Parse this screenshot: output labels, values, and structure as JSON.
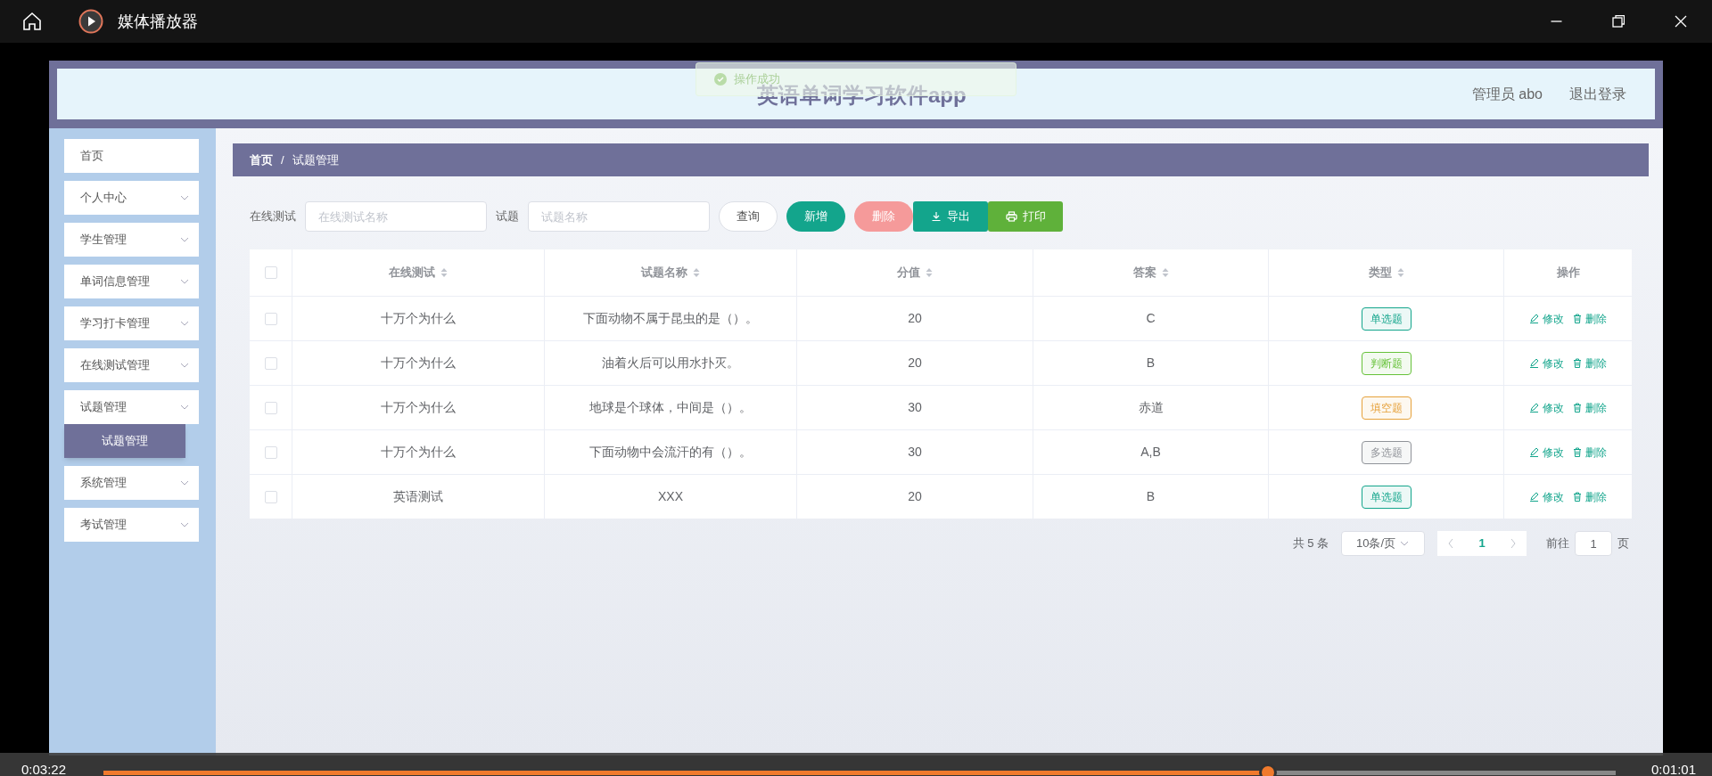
{
  "window": {
    "title": "媒体播放器"
  },
  "toast": {
    "text": "操作成功"
  },
  "header": {
    "title": "英语单词学习软件app",
    "user": "管理员 abo",
    "logout": "退出登录"
  },
  "sidebar": {
    "items": [
      {
        "label": "首页",
        "kind": "link"
      },
      {
        "label": "个人中心",
        "kind": "submenu"
      },
      {
        "label": "学生管理",
        "kind": "submenu"
      },
      {
        "label": "单词信息管理",
        "kind": "submenu"
      },
      {
        "label": "学习打卡管理",
        "kind": "submenu"
      },
      {
        "label": "在线测试管理",
        "kind": "submenu"
      },
      {
        "label": "试题管理",
        "kind": "submenu",
        "children": [
          {
            "label": "试题管理",
            "selected": true
          }
        ]
      },
      {
        "label": "系统管理",
        "kind": "submenu"
      },
      {
        "label": "考试管理",
        "kind": "submenu"
      }
    ]
  },
  "breadcrumb": [
    "首页",
    "/",
    "试题管理"
  ],
  "search": [
    {
      "label": "在线测试",
      "placeholder": "在线测试名称"
    },
    {
      "label": "试题",
      "placeholder": "试题名称"
    }
  ],
  "buttons": [
    {
      "label": "查询",
      "kind": "query"
    },
    {
      "label": "新增",
      "kind": "add"
    },
    {
      "label": "删除",
      "kind": "delete",
      "disabled": true
    },
    {
      "label": "导出",
      "kind": "export"
    },
    {
      "label": "打印",
      "kind": "print"
    }
  ],
  "table": {
    "select_all": {
      "checked": false
    },
    "columns": [
      {
        "label": "在线测试",
        "sortable": true
      },
      {
        "label": "试题名称",
        "sortable": true
      },
      {
        "label": "分值",
        "sortable": true
      },
      {
        "label": "答案",
        "sortable": true
      },
      {
        "label": "类型",
        "sortable": true
      },
      {
        "label": "操作",
        "sortable": false
      }
    ],
    "rows": [
      {
        "checked": false,
        "cells": [
          "十万个为什么",
          "下面动物不属于昆虫的是（）。",
          "20",
          "C"
        ],
        "type": {
          "label": "单选题",
          "color": "#13a58c"
        },
        "actions": [
          "修改",
          "删除"
        ]
      },
      {
        "checked": false,
        "cells": [
          "十万个为什么",
          "油着火后可以用水扑灭。",
          "20",
          "B"
        ],
        "type": {
          "label": "判断题",
          "color": "#67c23a"
        },
        "actions": [
          "修改",
          "删除"
        ]
      },
      {
        "checked": false,
        "cells": [
          "十万个为什么",
          "地球是个球体，中间是（）。",
          "30",
          "赤道"
        ],
        "type": {
          "label": "填空题",
          "color": "#e6a23c"
        },
        "actions": [
          "修改",
          "删除"
        ]
      },
      {
        "checked": false,
        "cells": [
          "十万个为什么",
          "下面动物中会流汗的有（）。",
          "30",
          "A,B"
        ],
        "type": {
          "label": "多选题",
          "color": "#909399"
        },
        "actions": [
          "修改",
          "删除"
        ]
      },
      {
        "checked": false,
        "cells": [
          "英语测试",
          "XXX",
          "20",
          "B"
        ],
        "type": {
          "label": "单选题",
          "color": "#13a58c"
        },
        "actions": [
          "修改",
          "删除"
        ]
      }
    ]
  },
  "pagination": {
    "total": "共 5 条",
    "page_size": "10条/页",
    "pages": [
      {
        "label": "1",
        "selected": true
      }
    ],
    "goto_label": "前往",
    "goto_value": "1",
    "goto_suffix": "页"
  },
  "player": {
    "elapsed": "0:03:22",
    "remaining": "0:01:01",
    "level": 0.77
  }
}
